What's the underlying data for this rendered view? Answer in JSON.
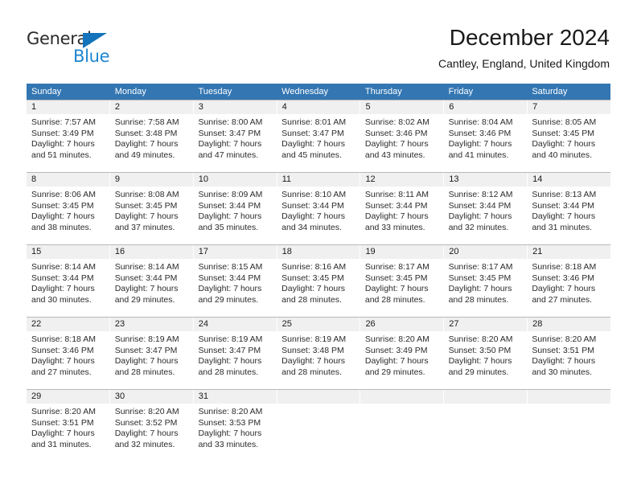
{
  "brand": {
    "name_part1": "General",
    "name_part2": "Blue",
    "triangle_icon": "triangle-icon",
    "color_dark": "#2b2b2b",
    "color_blue": "#1f86d0"
  },
  "header": {
    "title": "December 2024",
    "subtitle": "Cantley, England, United Kingdom"
  },
  "theme": {
    "header_blue": "#3376b2",
    "date_band_gray": "#f0f0f0",
    "row_divider": "#b8b8b8",
    "text": "#1a1a1a"
  },
  "weekdays": [
    "Sunday",
    "Monday",
    "Tuesday",
    "Wednesday",
    "Thursday",
    "Friday",
    "Saturday"
  ],
  "weeks": [
    {
      "dates": [
        "1",
        "2",
        "3",
        "4",
        "5",
        "6",
        "7"
      ],
      "cells": [
        {
          "l1": "Sunrise: 7:57 AM",
          "l2": "Sunset: 3:49 PM",
          "l3": "Daylight: 7 hours",
          "l4": "and 51 minutes."
        },
        {
          "l1": "Sunrise: 7:58 AM",
          "l2": "Sunset: 3:48 PM",
          "l3": "Daylight: 7 hours",
          "l4": "and 49 minutes."
        },
        {
          "l1": "Sunrise: 8:00 AM",
          "l2": "Sunset: 3:47 PM",
          "l3": "Daylight: 7 hours",
          "l4": "and 47 minutes."
        },
        {
          "l1": "Sunrise: 8:01 AM",
          "l2": "Sunset: 3:47 PM",
          "l3": "Daylight: 7 hours",
          "l4": "and 45 minutes."
        },
        {
          "l1": "Sunrise: 8:02 AM",
          "l2": "Sunset: 3:46 PM",
          "l3": "Daylight: 7 hours",
          "l4": "and 43 minutes."
        },
        {
          "l1": "Sunrise: 8:04 AM",
          "l2": "Sunset: 3:46 PM",
          "l3": "Daylight: 7 hours",
          "l4": "and 41 minutes."
        },
        {
          "l1": "Sunrise: 8:05 AM",
          "l2": "Sunset: 3:45 PM",
          "l3": "Daylight: 7 hours",
          "l4": "and 40 minutes."
        }
      ]
    },
    {
      "dates": [
        "8",
        "9",
        "10",
        "11",
        "12",
        "13",
        "14"
      ],
      "cells": [
        {
          "l1": "Sunrise: 8:06 AM",
          "l2": "Sunset: 3:45 PM",
          "l3": "Daylight: 7 hours",
          "l4": "and 38 minutes."
        },
        {
          "l1": "Sunrise: 8:08 AM",
          "l2": "Sunset: 3:45 PM",
          "l3": "Daylight: 7 hours",
          "l4": "and 37 minutes."
        },
        {
          "l1": "Sunrise: 8:09 AM",
          "l2": "Sunset: 3:44 PM",
          "l3": "Daylight: 7 hours",
          "l4": "and 35 minutes."
        },
        {
          "l1": "Sunrise: 8:10 AM",
          "l2": "Sunset: 3:44 PM",
          "l3": "Daylight: 7 hours",
          "l4": "and 34 minutes."
        },
        {
          "l1": "Sunrise: 8:11 AM",
          "l2": "Sunset: 3:44 PM",
          "l3": "Daylight: 7 hours",
          "l4": "and 33 minutes."
        },
        {
          "l1": "Sunrise: 8:12 AM",
          "l2": "Sunset: 3:44 PM",
          "l3": "Daylight: 7 hours",
          "l4": "and 32 minutes."
        },
        {
          "l1": "Sunrise: 8:13 AM",
          "l2": "Sunset: 3:44 PM",
          "l3": "Daylight: 7 hours",
          "l4": "and 31 minutes."
        }
      ]
    },
    {
      "dates": [
        "15",
        "16",
        "17",
        "18",
        "19",
        "20",
        "21"
      ],
      "cells": [
        {
          "l1": "Sunrise: 8:14 AM",
          "l2": "Sunset: 3:44 PM",
          "l3": "Daylight: 7 hours",
          "l4": "and 30 minutes."
        },
        {
          "l1": "Sunrise: 8:14 AM",
          "l2": "Sunset: 3:44 PM",
          "l3": "Daylight: 7 hours",
          "l4": "and 29 minutes."
        },
        {
          "l1": "Sunrise: 8:15 AM",
          "l2": "Sunset: 3:44 PM",
          "l3": "Daylight: 7 hours",
          "l4": "and 29 minutes."
        },
        {
          "l1": "Sunrise: 8:16 AM",
          "l2": "Sunset: 3:45 PM",
          "l3": "Daylight: 7 hours",
          "l4": "and 28 minutes."
        },
        {
          "l1": "Sunrise: 8:17 AM",
          "l2": "Sunset: 3:45 PM",
          "l3": "Daylight: 7 hours",
          "l4": "and 28 minutes."
        },
        {
          "l1": "Sunrise: 8:17 AM",
          "l2": "Sunset: 3:45 PM",
          "l3": "Daylight: 7 hours",
          "l4": "and 28 minutes."
        },
        {
          "l1": "Sunrise: 8:18 AM",
          "l2": "Sunset: 3:46 PM",
          "l3": "Daylight: 7 hours",
          "l4": "and 27 minutes."
        }
      ]
    },
    {
      "dates": [
        "22",
        "23",
        "24",
        "25",
        "26",
        "27",
        "28"
      ],
      "cells": [
        {
          "l1": "Sunrise: 8:18 AM",
          "l2": "Sunset: 3:46 PM",
          "l3": "Daylight: 7 hours",
          "l4": "and 27 minutes."
        },
        {
          "l1": "Sunrise: 8:19 AM",
          "l2": "Sunset: 3:47 PM",
          "l3": "Daylight: 7 hours",
          "l4": "and 28 minutes."
        },
        {
          "l1": "Sunrise: 8:19 AM",
          "l2": "Sunset: 3:47 PM",
          "l3": "Daylight: 7 hours",
          "l4": "and 28 minutes."
        },
        {
          "l1": "Sunrise: 8:19 AM",
          "l2": "Sunset: 3:48 PM",
          "l3": "Daylight: 7 hours",
          "l4": "and 28 minutes."
        },
        {
          "l1": "Sunrise: 8:20 AM",
          "l2": "Sunset: 3:49 PM",
          "l3": "Daylight: 7 hours",
          "l4": "and 29 minutes."
        },
        {
          "l1": "Sunrise: 8:20 AM",
          "l2": "Sunset: 3:50 PM",
          "l3": "Daylight: 7 hours",
          "l4": "and 29 minutes."
        },
        {
          "l1": "Sunrise: 8:20 AM",
          "l2": "Sunset: 3:51 PM",
          "l3": "Daylight: 7 hours",
          "l4": "and 30 minutes."
        }
      ]
    },
    {
      "dates": [
        "29",
        "30",
        "31",
        "",
        "",
        "",
        ""
      ],
      "cells": [
        {
          "l1": "Sunrise: 8:20 AM",
          "l2": "Sunset: 3:51 PM",
          "l3": "Daylight: 7 hours",
          "l4": "and 31 minutes."
        },
        {
          "l1": "Sunrise: 8:20 AM",
          "l2": "Sunset: 3:52 PM",
          "l3": "Daylight: 7 hours",
          "l4": "and 32 minutes."
        },
        {
          "l1": "Sunrise: 8:20 AM",
          "l2": "Sunset: 3:53 PM",
          "l3": "Daylight: 7 hours",
          "l4": "and 33 minutes."
        },
        {
          "l1": "",
          "l2": "",
          "l3": "",
          "l4": ""
        },
        {
          "l1": "",
          "l2": "",
          "l3": "",
          "l4": ""
        },
        {
          "l1": "",
          "l2": "",
          "l3": "",
          "l4": ""
        },
        {
          "l1": "",
          "l2": "",
          "l3": "",
          "l4": ""
        }
      ]
    }
  ]
}
